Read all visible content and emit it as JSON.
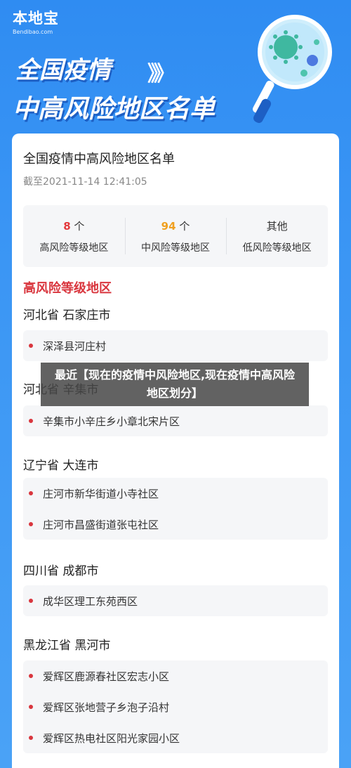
{
  "brand": {
    "name": "本地宝",
    "domain": "Bendibao.com"
  },
  "hero": {
    "line1": "全国疫情",
    "arrows": "》》",
    "line2": "中高风险地区名单"
  },
  "card": {
    "title": "全国疫情中高风险地区名单",
    "date": "截至2021-11-14 12:41:05",
    "summary": [
      {
        "count": "8",
        "unit": " 个",
        "label": "高风险等级地区",
        "color": "#e4393c"
      },
      {
        "count": "94",
        "unit": " 个",
        "label": "中风险等级地区",
        "color": "#f0a020"
      },
      {
        "count": "其他",
        "unit": "",
        "label": "低风险等级地区",
        "color": "#333333"
      }
    ],
    "section_title": "高风险等级地区",
    "groups": [
      {
        "city": "河北省 石家庄市",
        "areas": [
          "深泽县河庄村"
        ]
      },
      {
        "city": "河北省 辛集市",
        "areas": [
          "辛集市小辛庄乡小章北宋片区"
        ]
      },
      {
        "city": "辽宁省 大连市",
        "areas": [
          "庄河市新华街道小寺社区",
          "庄河市昌盛街道张屯社区"
        ]
      },
      {
        "city": "四川省 成都市",
        "areas": [
          "成华区理工东苑西区"
        ]
      },
      {
        "city": "黑龙江省 黑河市",
        "areas": [
          "爱辉区鹿源春社区宏志小区",
          "爱辉区张地营子乡泡子沿村",
          "爱辉区热电社区阳光家园小区"
        ]
      }
    ]
  },
  "banner": {
    "text": "最近【现在的疫情中风险地区,现在疫情中高风险地区划分】"
  }
}
